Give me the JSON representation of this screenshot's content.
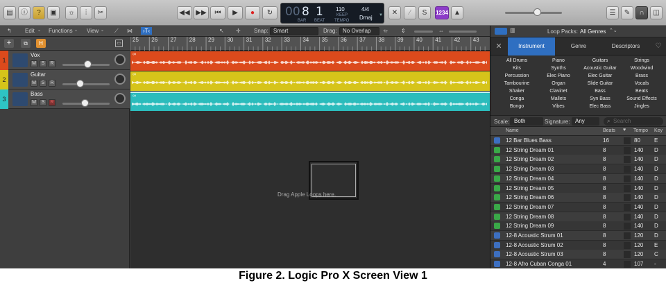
{
  "lcd": {
    "bar": "8",
    "beat": "1",
    "bar_label": "BAR",
    "beat_label": "BEAT",
    "tempo": "110",
    "tempo_mode": "KEEP",
    "tempo_label": "TEMPO",
    "signature": "4/4",
    "key": "Dmaj",
    "prefix": "00"
  },
  "control_bar": {
    "count_in": "1234",
    "accent_yellow": "#d4a83a",
    "accent_purple": "#8c3cc8"
  },
  "tracks_toolbar": {
    "edit": "Edit",
    "functions": "Functions",
    "view": "View",
    "snap_label": "Snap:",
    "snap_value": "Smart",
    "drag_label": "Drag:",
    "drag_value": "No Overlap"
  },
  "ruler": [
    "25",
    "26",
    "27",
    "28",
    "29",
    "30",
    "31",
    "32",
    "33",
    "34",
    "35",
    "36",
    "37",
    "38",
    "39",
    "40",
    "41",
    "42",
    "43"
  ],
  "tracks": [
    {
      "num": "1",
      "name": "Vox",
      "color": "#dc4a1c",
      "m": "M",
      "s": "S",
      "r": "R"
    },
    {
      "num": "2",
      "name": "Guitar",
      "color": "#d6c41a",
      "m": "M",
      "s": "S",
      "r": "R"
    },
    {
      "num": "3",
      "name": "Bass",
      "color": "#2ec4c4",
      "m": "M",
      "s": "S",
      "r": "R"
    }
  ],
  "track_header": {
    "h": "H",
    "add": "+"
  },
  "drop_hint": "Drag Apple Loops here.",
  "loops": {
    "packs_label": "Loop Packs:",
    "packs_value": "All Genres",
    "tabs": [
      "Instrument",
      "Genre",
      "Descriptors"
    ],
    "instruments": [
      [
        "All Drums",
        "Piano",
        "Guitars",
        "Strings"
      ],
      [
        "Kits",
        "Synths",
        "Acoustic Guitar",
        "Woodwind"
      ],
      [
        "Percussion",
        "Elec Piano",
        "Elec Guitar",
        "Brass"
      ],
      [
        "Tambourine",
        "Organ",
        "Slide Guitar",
        "Vocals"
      ],
      [
        "Shaker",
        "Clavinet",
        "Bass",
        "Beats"
      ],
      [
        "Conga",
        "Mallets",
        "Syn Bass",
        "Sound Effects"
      ],
      [
        "Bongo",
        "Vibes",
        "Elec Bass",
        "Jingles"
      ]
    ],
    "scale_label": "Scale:",
    "scale_value": "Both",
    "signature_label": "Signature:",
    "signature_value": "Any",
    "search_placeholder": "Search",
    "columns": [
      "Name",
      "Beats",
      "Tempo",
      "Key"
    ],
    "rows": [
      {
        "name": "12 Bar Blues Bass",
        "beats": "16",
        "tempo": "80",
        "key": "E",
        "icon": "blue"
      },
      {
        "name": "12 String Dream 01",
        "beats": "8",
        "tempo": "140",
        "key": "D",
        "icon": "green"
      },
      {
        "name": "12 String Dream 02",
        "beats": "8",
        "tempo": "140",
        "key": "D",
        "icon": "green"
      },
      {
        "name": "12 String Dream 03",
        "beats": "8",
        "tempo": "140",
        "key": "D",
        "icon": "green"
      },
      {
        "name": "12 String Dream 04",
        "beats": "8",
        "tempo": "140",
        "key": "D",
        "icon": "green"
      },
      {
        "name": "12 String Dream 05",
        "beats": "8",
        "tempo": "140",
        "key": "D",
        "icon": "green"
      },
      {
        "name": "12 String Dream 06",
        "beats": "8",
        "tempo": "140",
        "key": "D",
        "icon": "green"
      },
      {
        "name": "12 String Dream 07",
        "beats": "8",
        "tempo": "140",
        "key": "D",
        "icon": "green"
      },
      {
        "name": "12 String Dream 08",
        "beats": "8",
        "tempo": "140",
        "key": "D",
        "icon": "green"
      },
      {
        "name": "12 String Dream 09",
        "beats": "8",
        "tempo": "140",
        "key": "D",
        "icon": "green"
      },
      {
        "name": "12-8 Acoustic Strum 01",
        "beats": "8",
        "tempo": "120",
        "key": "D",
        "icon": "blue"
      },
      {
        "name": "12-8 Acoustic Strum 02",
        "beats": "8",
        "tempo": "120",
        "key": "E",
        "icon": "blue"
      },
      {
        "name": "12-8 Acoustic Strum 03",
        "beats": "8",
        "tempo": "120",
        "key": "C",
        "icon": "blue"
      },
      {
        "name": "12-8 Afro Cuban Conga 01",
        "beats": "4",
        "tempo": "107",
        "key": "-",
        "icon": "blue"
      }
    ]
  },
  "caption": "Figure 2. Logic Pro X Screen View 1"
}
